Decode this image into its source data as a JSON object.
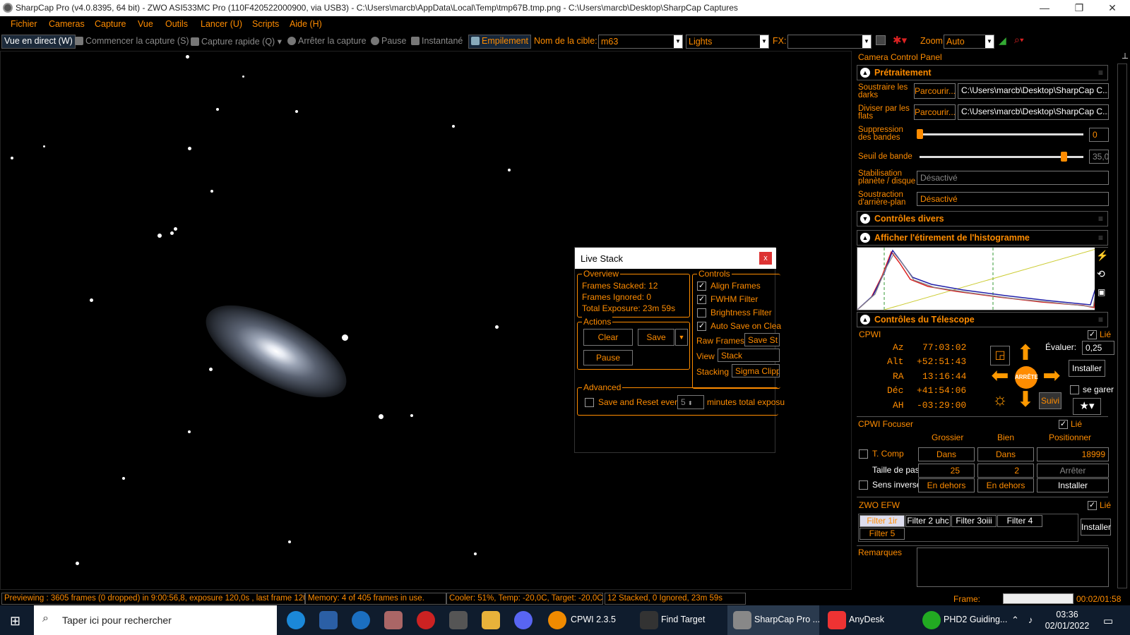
{
  "window": {
    "title": "SharpCap Pro (v4.0.8395, 64 bit) - ZWO ASI533MC Pro (110F420522000900, via USB3) - C:\\Users\\marcb\\AppData\\Local\\Temp\\tmp67B.tmp.png - C:\\Users\\marcb\\Desktop\\SharpCap Captures",
    "min": "—",
    "max": "❐",
    "close": "✕"
  },
  "menu": [
    "Fichier",
    "Cameras",
    "Capture",
    "Vue",
    "Outils",
    "Lancer (U)",
    "Scripts",
    "Aide (H)"
  ],
  "toolbar": {
    "live": "Vue en direct (W)",
    "start": "Commencer la capture (S)",
    "quick": "Capture rapide (Q)",
    "stop": "Arrêter la capture",
    "pause": "Pause",
    "snap": "Instantané",
    "stack": "Empilement",
    "target_label": "Nom de la cible:",
    "target": "m63",
    "frame_type": "Lights",
    "fx_label": "FX:",
    "fx": "",
    "zoom_label": "Zoom:",
    "zoom": "Auto"
  },
  "livestack": {
    "title": "Live Stack",
    "close": "x",
    "overview": {
      "label": "Overview",
      "stacked": "Frames Stacked:  12",
      "ignored": "Frames Ignored:  0",
      "exposure": "Total Exposure:    23m 59s"
    },
    "actions": {
      "label": "Actions",
      "clear": "Clear",
      "save": "Save",
      "pause": "Pause"
    },
    "controls": {
      "label": "Controls",
      "align": "Align Frames",
      "fwhm": "FWHM Filter",
      "bright": "Brightness Filter",
      "autosave": "Auto Save on Clea",
      "raw_label": "Raw Frames",
      "raw": "Save St",
      "view_label": "View",
      "view": "Stack",
      "stacking_label": "Stacking",
      "stacking": "Sigma Clipp"
    },
    "advanced": {
      "label": "Advanced",
      "text": "Save and Reset every",
      "value": "5",
      "suffix": "minutes total exposu"
    }
  },
  "panel": {
    "title": "Camera Control Panel",
    "pre": {
      "title": "Prétraitement",
      "darks": "Soustraire les darks",
      "flats": "Diviser par les flats",
      "browse": "Parcourir...",
      "darks_path": "C:\\Users\\marcb\\Desktop\\SharpCap C...",
      "flats_path": "C:\\Users\\marcb\\Desktop\\SharpCap C...",
      "banding": "Suppression des bandes",
      "banding_val": "0",
      "banding_level": 0.0,
      "threshold": "Seuil de bande",
      "threshold_val": "35,0",
      "threshold_level": 0.88,
      "stab": "Stabilisation planète / disque",
      "stab_val": "Désactivé",
      "bgsub": "Soustraction d'arrière-plan",
      "bgsub_val": "Désactivé"
    },
    "misc": {
      "title": "Contrôles divers"
    },
    "histo": {
      "title": "Afficher l'étirement de l'histogramme"
    },
    "tel": {
      "title": "Contrôles du Télescope",
      "name": "CPWI",
      "linked": "Lié",
      "az_l": "Az",
      "az": "77:03:02",
      "alt_l": "Alt",
      "alt": "+52:51:43",
      "ra_l": "RA",
      "ra": "13:16:44",
      "dec_l": "Déc",
      "dec": "+41:54:06",
      "ah_l": "AH",
      "ah": "-03:29:00",
      "rate_l": "Évaluer:",
      "rate": "0,25",
      "install": "Installer",
      "stop": "ARRÊTE",
      "park": "se garer",
      "track": "Suivi"
    },
    "focus": {
      "title": "CPWI Focuser",
      "linked": "Lié",
      "coarse": "Grossier",
      "fine": "Bien",
      "position": "Positionner",
      "tcomp": "T. Comp",
      "in": "Dans",
      "pos": "18999",
      "step_l": "Taille de pas",
      "step1": "25",
      "step2": "2",
      "stop": "Arrêter",
      "reverse": "Sens inverse",
      "out": "En dehors",
      "install": "Installer"
    },
    "efw": {
      "title": "ZWO EFW",
      "linked": "Lié",
      "filters": [
        "Filter 1ir",
        "Filter 2 uhc",
        "Filter 3oiii",
        "Filter 4",
        "Filter 5"
      ],
      "install": "Installer"
    },
    "notes": {
      "label": "Remarques"
    }
  },
  "status": {
    "preview": "Previewing : 3605 frames (0 dropped) in 9:00:56,8, exposure 120,0s , last frame 120",
    "memory": "Memory: 4 of 405 frames in use.",
    "cooler": "Cooler: 51%, Temp: -20,0C, Target: -20,0C",
    "stacked": "12 Stacked, 0 Ignored, 23m 59s",
    "frame_label": "Frame:",
    "time": "00:02/01:58"
  },
  "taskbar": {
    "search": "Taper ici pour rechercher",
    "apps": [
      "CPWI 2.3.5",
      "Find Target",
      "SharpCap Pro ...",
      "AnyDesk",
      "PHD2 Guiding..."
    ],
    "clock": "03:36",
    "date": "02/01/2022"
  }
}
